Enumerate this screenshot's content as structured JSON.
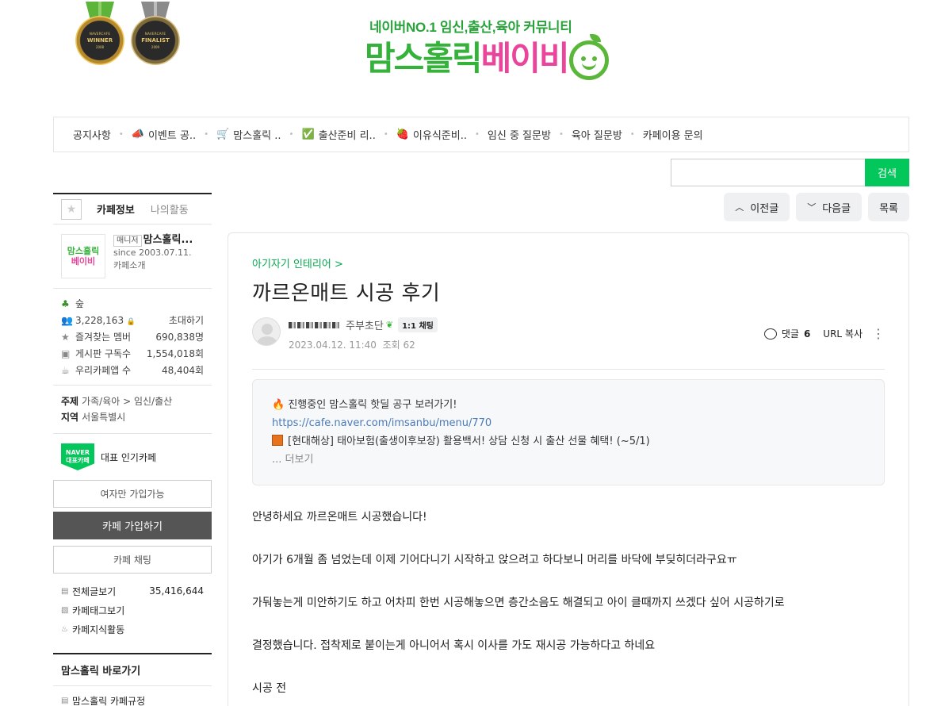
{
  "header": {
    "medals": [
      {
        "top": "NAVERCAFE",
        "word": "WINNER",
        "year": "2008"
      },
      {
        "top": "NAVERCAFE",
        "word": "FINALIST",
        "year": "2009"
      }
    ],
    "tagline": "네이버NO.1 임신,출산,육아 커뮤니티",
    "logo_part1": "맘스홀릭",
    "logo_part2": "베이비"
  },
  "menu": [
    {
      "label": "공지사항",
      "icon": ""
    },
    {
      "label": "이벤트 공..",
      "icon": "📣"
    },
    {
      "label": "맘스홀릭 ..",
      "icon": "🛒"
    },
    {
      "label": "출산준비 리..",
      "icon": "✅"
    },
    {
      "label": "이유식준비..",
      "icon": "🍓"
    },
    {
      "label": "임신 중 질문방",
      "icon": ""
    },
    {
      "label": "육아 질문방",
      "icon": ""
    },
    {
      "label": "카페이용 문의",
      "icon": ""
    }
  ],
  "search": {
    "button": "검색",
    "placeholder": ""
  },
  "sidebar": {
    "tab_info": "카페정보",
    "tab_activity": "나의활동",
    "thumb_line1": "맘스홀릭",
    "thumb_line2": "베이비",
    "manager_badge": "매니저",
    "cafe_name": "맘스홀릭...",
    "since": "since 2003.07.11.",
    "intro": "카페소개",
    "level": "숲",
    "members": "3,228,163",
    "invite": "초대하기",
    "stats": [
      {
        "label": "즐겨찾는 멤버",
        "value": "690,838명"
      },
      {
        "label": "게시판 구독수",
        "value": "1,554,018회"
      },
      {
        "label": "우리카페앱 수",
        "value": "48,404회"
      }
    ],
    "topic_label": "주제",
    "topic_value": "가족/육아 > 임신/출산",
    "region_label": "지역",
    "region_value": "서울특별시",
    "naver_badge1": "NAVER",
    "naver_badge2": "대표카페",
    "rep_cafe": "대표 인기카페",
    "women_only": "여자만 가입가능",
    "join": "카페 가입하기",
    "chat": "카페 채팅",
    "links": [
      {
        "label": "전체글보기",
        "value": "35,416,644"
      },
      {
        "label": "카페태그보기",
        "value": ""
      },
      {
        "label": "카페지식활동",
        "value": ""
      }
    ],
    "shortcut_title": "맘스홀릭 바로가기",
    "shortcut_first": "맘스홀릭 카페규정"
  },
  "nav": {
    "prev": "이전글",
    "next": "다음글",
    "list": "목록"
  },
  "article": {
    "board": "아기자기 인테리어 >",
    "title": "까르온매트 시공 후기",
    "grade": "주부초단",
    "chat_badge": "1:1 채팅",
    "date": "2023.04.12. 11:40",
    "views": "조회 62",
    "comments_label": "댓글",
    "comments_count": "6",
    "url_copy": "URL 복사",
    "notice_line1": "진행중인 맘스홀릭 핫딜 공구 보러가기!",
    "notice_link": "https://cafe.naver.com/imsanbu/menu/770",
    "notice_line2": "[현대해상] 태아보험(출생이후보장) 활용백서! 상담 신청 시 출산 선물 혜택! (~5/1)",
    "notice_more": "... 더보기",
    "paragraphs": [
      "안녕하세요 까르온매트 시공했습니다!",
      "아기가 6개월 좀 넘었는데 이제 기어다니기 시작하고 앉으려고 하다보니 머리를 바닥에 부딪히더라구요ㅠ",
      "가둬놓는게 미안하기도 하고 어차피 한번 시공해놓으면 층간소음도 해결되고 아이 클때까지 쓰겠다 싶어 시공하기로",
      "결정했습니다. 접착제로 붙이는게 아니어서 혹시 이사를 가도 재시공 가능하다고 하네요",
      "시공 전"
    ]
  }
}
